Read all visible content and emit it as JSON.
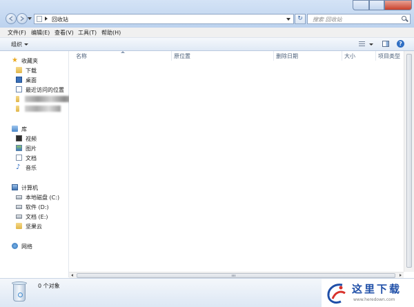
{
  "address": {
    "location": "回收站"
  },
  "search": {
    "placeholder": "搜索 回收站"
  },
  "menu": [
    "文件(F)",
    "编辑(E)",
    "查看(V)",
    "工具(T)",
    "帮助(H)"
  ],
  "toolbar": {
    "organize": "组织"
  },
  "nav": {
    "favorites": {
      "label": "收藏夹",
      "items": [
        "下载",
        "桌面",
        "最近访问的位置"
      ]
    },
    "libraries": {
      "label": "库",
      "items": [
        "视频",
        "图片",
        "文档",
        "音乐"
      ]
    },
    "computer": {
      "label": "计算机",
      "items": [
        "本地磁盘 (C:)",
        "软件 (D:)",
        "文档 (E:)",
        "坚果云"
      ]
    },
    "network": {
      "label": "网络"
    }
  },
  "columns": [
    "名称",
    "原位置",
    "删除日期",
    "大小",
    "项目类型"
  ],
  "details": {
    "count": "0 个对象"
  },
  "watermark": {
    "title": "这里下载",
    "url": "www.heredown.com"
  },
  "colors": {
    "accent": "#1f4fa8",
    "chrome": "#bcd2ee"
  }
}
